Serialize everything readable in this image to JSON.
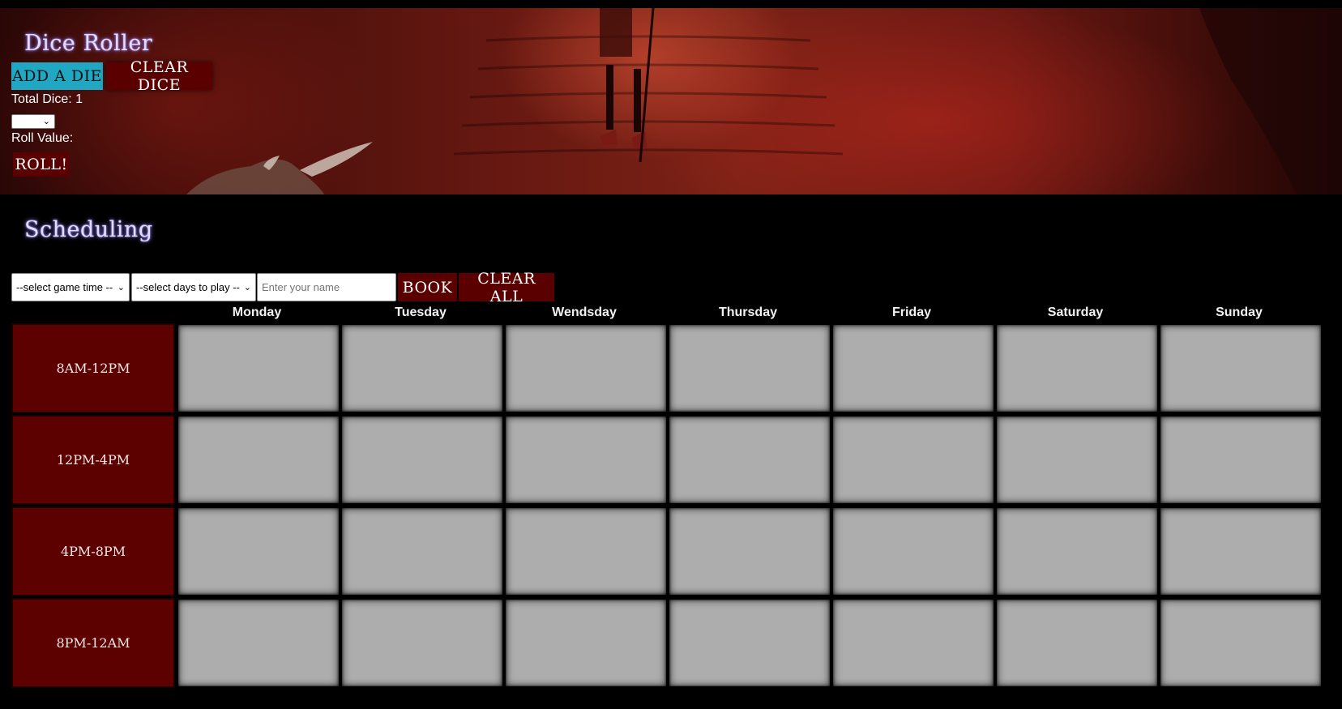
{
  "dice_roller": {
    "title": "Dice Roller",
    "add_die_label": "ADD A DIE",
    "clear_dice_label": "CLEAR DICE",
    "total_dice_label": "Total Dice: 1",
    "dice_select_value": "",
    "roll_value_label": "Roll Value:",
    "roll_label": "ROLL!"
  },
  "scheduling": {
    "title": "Scheduling",
    "game_time_select": "--select game time --",
    "days_select": "--select days to play --",
    "name_placeholder": "Enter your name",
    "book_label": "BOOK",
    "clear_all_label": "CLEAR ALL",
    "days": [
      "Monday",
      "Tuesday",
      "Wendsday",
      "Thursday",
      "Friday",
      "Saturday",
      "Sunday"
    ],
    "time_slots": [
      "8AM-12PM",
      "12PM-4PM",
      "4PM-8PM",
      "8PM-12AM"
    ]
  },
  "colors": {
    "accent_teal": "#22a7c2",
    "dark_red": "#5a0000",
    "cell_gray": "#adadad",
    "title_glow": "#8d7bff"
  }
}
